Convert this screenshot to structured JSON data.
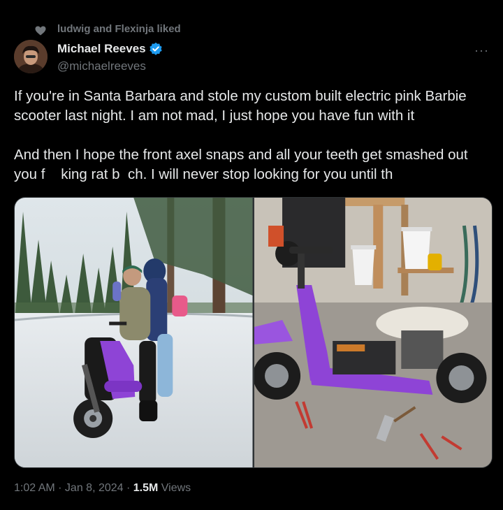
{
  "social_context": {
    "text": "ludwig and Flexinja liked"
  },
  "author": {
    "name": "Michael Reeves",
    "handle": "@michaelreeves"
  },
  "menu": {
    "label": "···"
  },
  "tweet": {
    "paragraph_1": "If you're in Santa Barbara and stole my custom built electric pink Barbie scooter last night. I am not mad, I just hope you have fun with it",
    "paragraph_2": "And then I hope the front axel snaps and all your teeth get smashed out you f    king rat b  ch. I will never stop looking for you until th"
  },
  "meta": {
    "time": "1:02 AM",
    "sep1": " · ",
    "date": "Jan 8, 2024",
    "sep2": " · ",
    "views_count": "1.5M",
    "views_label": " Views"
  },
  "colors": {
    "background": "#000000",
    "text": "#e7e9ea",
    "muted": "#71767b",
    "verified": "#1d9bf0",
    "scooter": "#8e44d6"
  }
}
